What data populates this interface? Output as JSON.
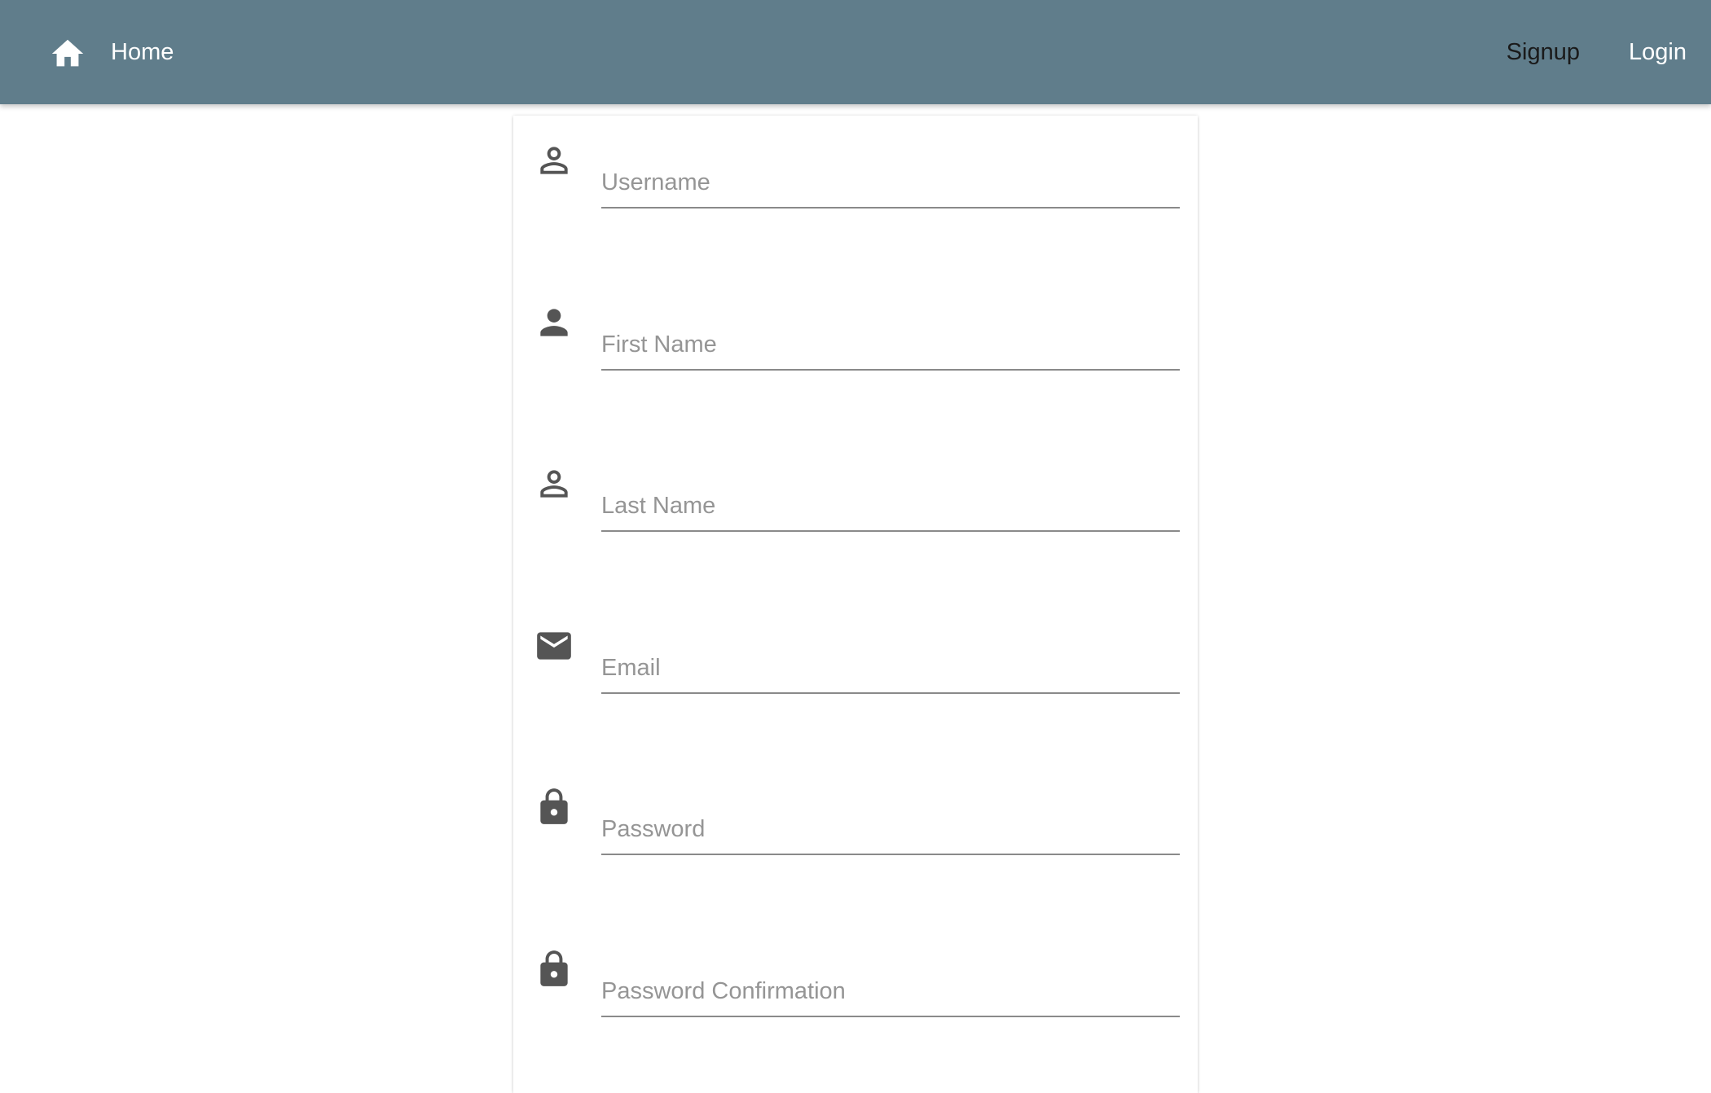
{
  "header": {
    "home_label": "Home",
    "home_icon": "home-icon",
    "nav": {
      "signup_label": "Signup",
      "login_label": "Login"
    },
    "colors": {
      "bar": "#607d8b",
      "text": "#ffffff"
    }
  },
  "form": {
    "fields": [
      {
        "placeholder": "Username",
        "icon": "person-outline-icon",
        "value": ""
      },
      {
        "placeholder": "First Name",
        "icon": "person-icon",
        "value": ""
      },
      {
        "placeholder": "Last Name",
        "icon": "person-outline-icon",
        "value": ""
      },
      {
        "placeholder": "Email",
        "icon": "email-icon",
        "value": ""
      },
      {
        "placeholder": "Password",
        "icon": "lock-icon",
        "value": ""
      },
      {
        "placeholder": "Password Confirmation",
        "icon": "lock-icon",
        "value": ""
      }
    ]
  }
}
